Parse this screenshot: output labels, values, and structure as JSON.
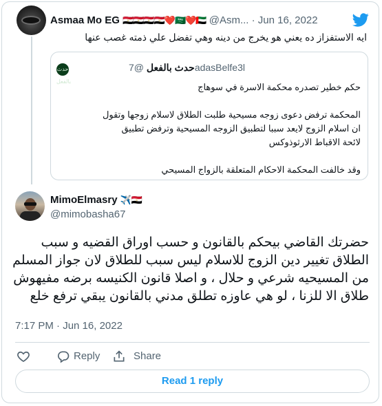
{
  "parent_tweet": {
    "author_name": "Asmaa Mo EG",
    "author_flags": "🇪🇬🇪🇬🇪🇬🇪🇬❤️🇸🇦❤️🇦🇪",
    "handle": "@Asm...",
    "separator": "·",
    "date": "Jun 16, 2022",
    "text": "ايه الاستفزاز ده يعني هو يخرج من دينه وهي تفضل علي ذمته غصب عنها",
    "icon": "twitter-bird-icon"
  },
  "quoted_tweet": {
    "author_name": "حدث بالفعل",
    "handle": "@7adasBelfe3l",
    "avatar_text": "حدث بالفعل",
    "lines": [
      "حكم خطير تصدره محكمة الاسرة في سوهاج",
      "",
      "المحكمة ترفض دعوى زوجه مسيحية طلبت الطلاق لاسلام زوجها وتقول",
      "ان اسلام الزوج لايعد سببا لتطبيق الزوجه المسيحية وترفض تطبيق",
      "لائحة الاقباط الارثوذوكس",
      "",
      "وقد خالفت المحكمة  الاحكام المتعلقة بالزواج المسيحي"
    ]
  },
  "main_tweet": {
    "author_name": "MimoElmasry",
    "author_extra": "✈️🇪🇬",
    "handle": "@mimobasha67",
    "text": "حضرتك القاضي بيحكم بالقانون و حسب اوراق القضيه و سبب الطلاق تغيير دين الزوج للاسلام ليس سبب للطلاق لان جواز المسلم من المسيحيه شرعي و حلال ، و اصلا قانون الكنيسه برضه مفيهوش طلاق الا للزنا ، لو هي عاوزه تطلق مدني بالقانون يبقي ترفع خلع",
    "timestamp": "7:17 PM · Jun 16, 2022"
  },
  "actions": {
    "like_icon": "heart-icon",
    "reply_label": "Reply",
    "reply_icon": "reply-icon",
    "share_label": "Share",
    "share_icon": "share-icon"
  },
  "read_replies_label": "Read 1 reply",
  "colors": {
    "accent": "#1d9bf0",
    "secondary_text": "#536471",
    "border": "#cfd9de"
  }
}
